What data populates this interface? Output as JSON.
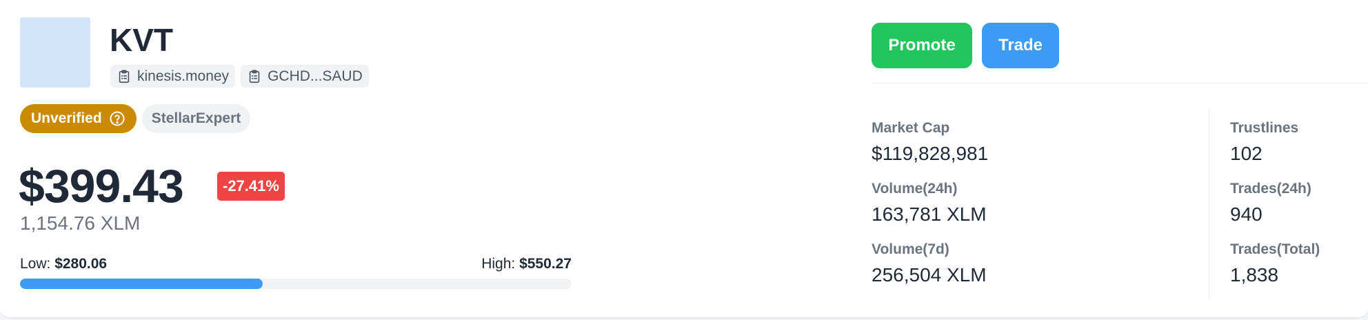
{
  "asset": {
    "code": "KVT",
    "domain": "kinesis.money",
    "issuer": "GCHD...SAUD",
    "domain_icon": "clipboard-icon",
    "issuer_icon": "clipboard-icon",
    "logo_color": "#d1e5fb"
  },
  "badges": {
    "unverified": "Unverified",
    "unverified_icon": "help-circle-icon",
    "explorer": "StellarExpert"
  },
  "price": {
    "usd": "$399.43",
    "change": "-27.41%",
    "xlm": "1,154.76 XLM"
  },
  "range": {
    "low_label": "Low:",
    "low_value": "$280.06",
    "high_label": "High:",
    "high_value": "$550.27",
    "fill_fraction": 0.44
  },
  "actions": {
    "promote": "Promote",
    "trade": "Trade"
  },
  "stats": {
    "market_cap": {
      "label": "Market Cap",
      "value": "$119,828,981"
    },
    "volume_24h": {
      "label": "Volume(24h)",
      "value": "163,781 XLM"
    },
    "volume_7d": {
      "label": "Volume(7d)",
      "value": "256,504 XLM"
    },
    "trustlines": {
      "label": "Trustlines",
      "value": "102"
    },
    "trades_24h": {
      "label": "Trades(24h)",
      "value": "940"
    },
    "trades_total": {
      "label": "Trades(Total)",
      "value": "1,838"
    }
  },
  "colors": {
    "promote": "#22c55e",
    "trade": "#3b9bf5",
    "unverified": "#ca8a04",
    "negative_change": "#ef4444",
    "range_fill": "#3b9bf5"
  }
}
